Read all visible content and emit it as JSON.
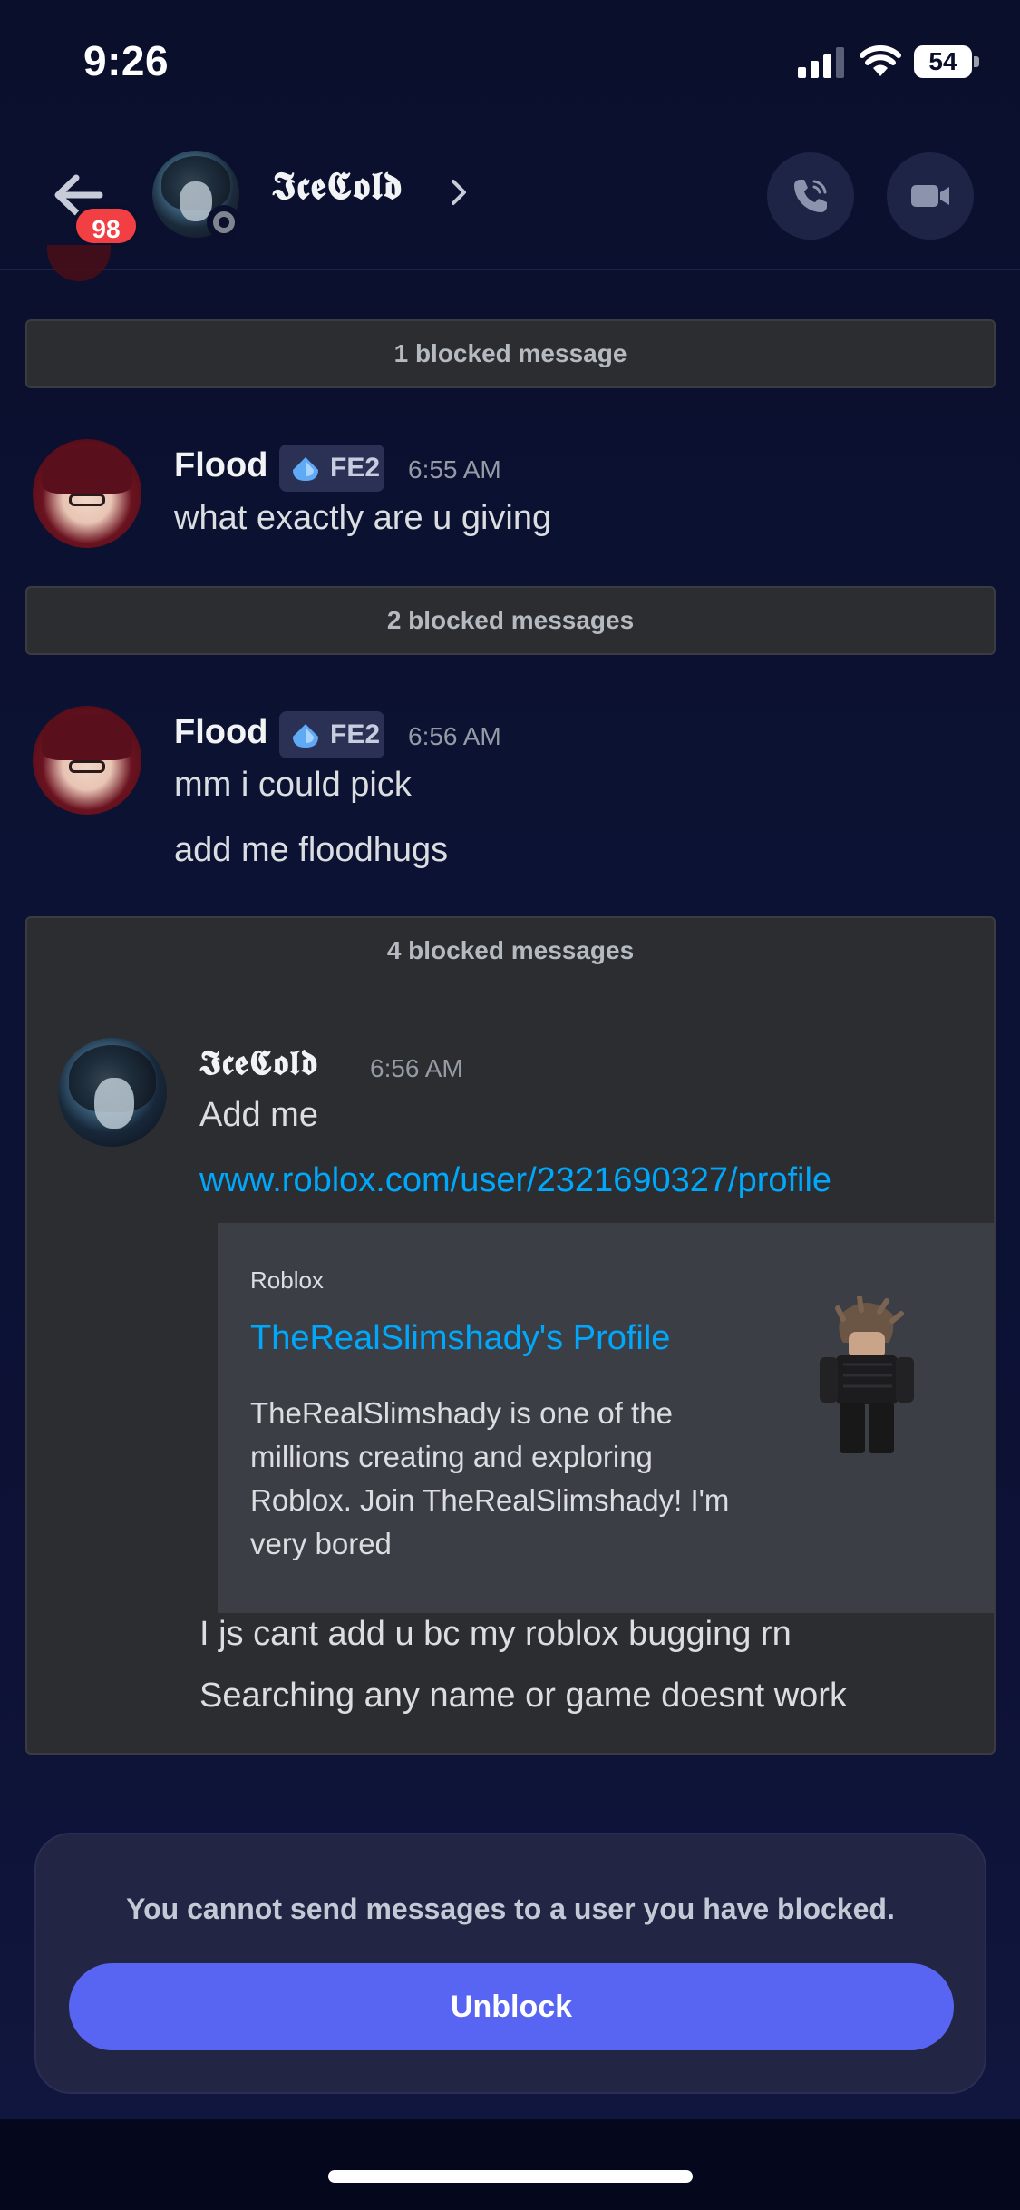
{
  "status_bar": {
    "time": "9:26",
    "battery": "54"
  },
  "header": {
    "unread_count": "98",
    "contact_name": "𝕴𝖈𝖊𝕮𝖔𝖑𝖉"
  },
  "messages": {
    "blocked_1": "1 blocked message",
    "group_1": {
      "author": "Flood",
      "tag": "FE2",
      "time": "6:55 AM",
      "lines": [
        "what exactly are u giving"
      ]
    },
    "blocked_2": "2 blocked messages",
    "group_2": {
      "author": "Flood",
      "tag": "FE2",
      "time": "6:56 AM",
      "lines": [
        "mm i could pick",
        "add me floodhugs"
      ]
    },
    "blocked_4": {
      "label": "4 blocked messages",
      "author": "𝕴𝖈𝖊𝕮𝖔𝖑𝖉",
      "time": "6:56 AM",
      "line_1": "Add me",
      "link": "www.roblox.com/user/2321690327/profile",
      "embed": {
        "provider": "Roblox",
        "title": "TheRealSlimshady's Profile",
        "description": "TheRealSlimshady is one of the millions creating and exploring Roblox. Join TheRealSlimshady! I'm very bored"
      },
      "line_2": "I js cant add u bc my roblox bugging rn",
      "line_3": "Searching any name or game doesnt work"
    }
  },
  "composer": {
    "blocked_text": "You cannot send messages to a user you have blocked.",
    "unblock_label": "Unblock"
  },
  "colors": {
    "accent": "#5865f2",
    "link": "#00a8fc",
    "badge": "#f23f43"
  }
}
